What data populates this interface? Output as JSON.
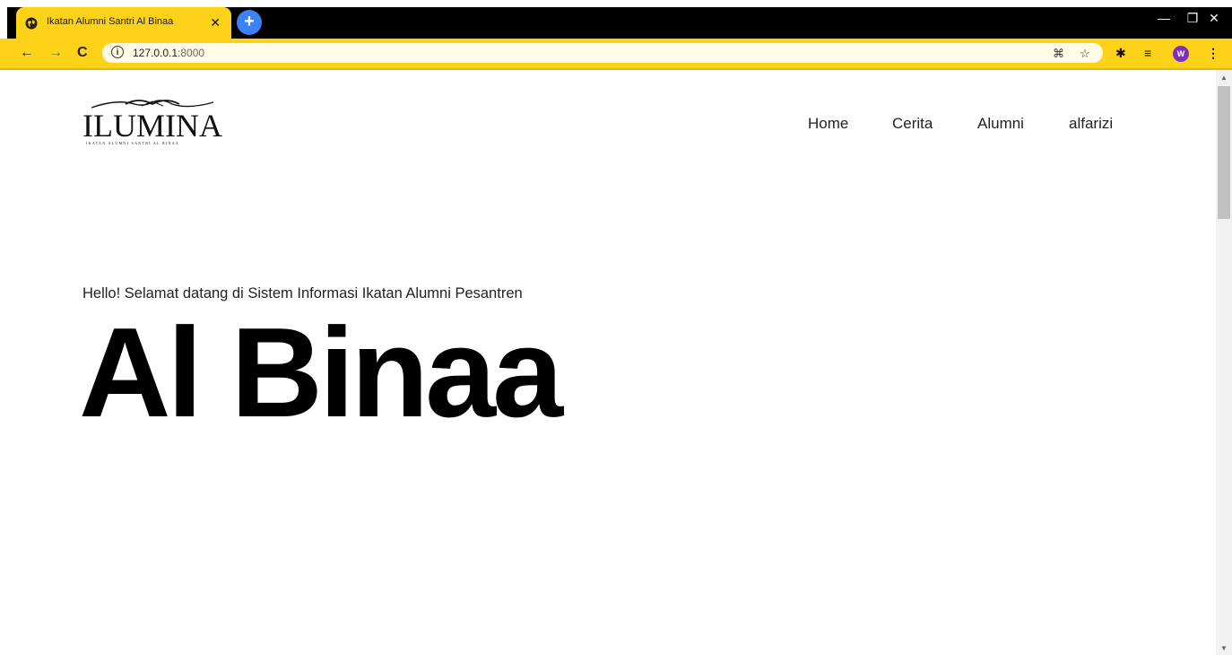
{
  "browser": {
    "tab_title": "Ikatan Alumni Santri Al Binaa",
    "tab_close": "✕",
    "new_tab": "+",
    "url_host": "127.0.0.1",
    "url_port": ":8000",
    "avatar_letter": "W",
    "accent_color": "#ffd21a"
  },
  "site": {
    "logo_text": "ILUMINA",
    "logo_subtitle": "IKATAN ALUMNI SANTRI AL BINAA",
    "nav": [
      {
        "label": "Home"
      },
      {
        "label": "Cerita"
      },
      {
        "label": "Alumni"
      },
      {
        "label": "alfarizi"
      }
    ],
    "greeting": "Hello! Selamat datang di Sistem Informasi Ikatan Alumni Pesantren",
    "hero_title": "Al Binaa"
  }
}
